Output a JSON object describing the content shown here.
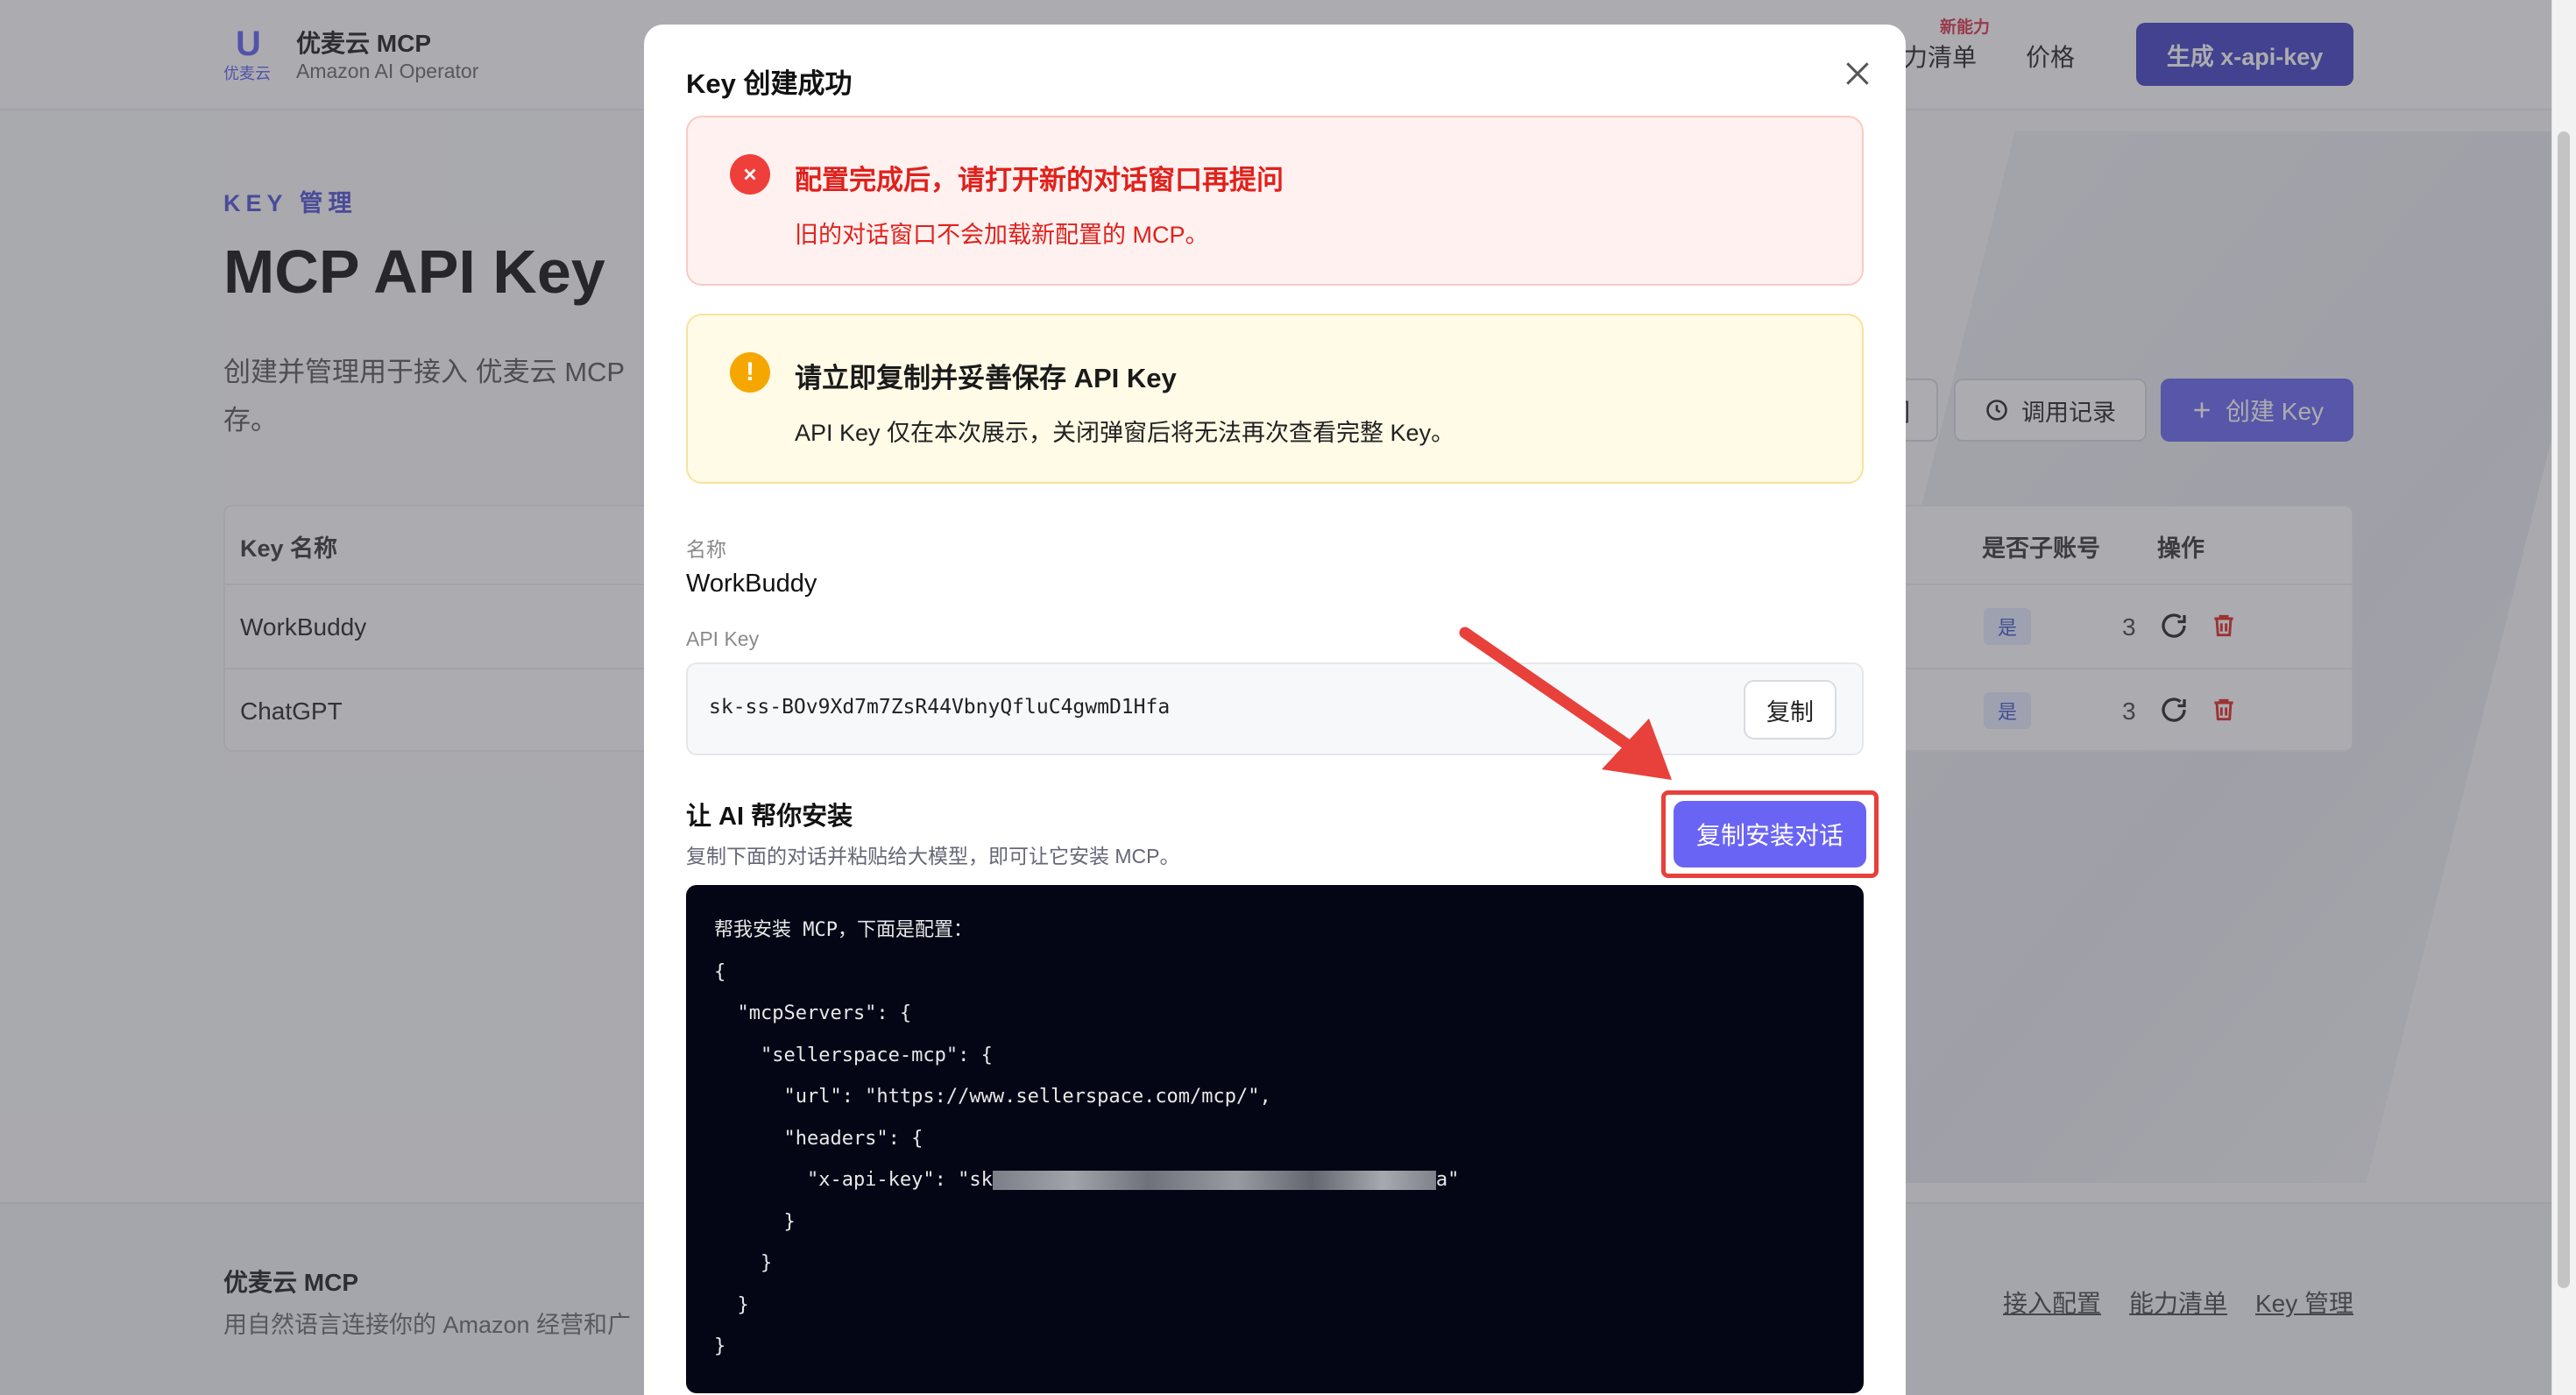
{
  "header": {
    "logo_letter": "U",
    "logo_text": "优麦云",
    "brand_name": "优麦云 MCP",
    "brand_sub": "Amazon AI Operator",
    "nav_capabilities": "力清单",
    "nav_badge": "新能力",
    "nav_pricing": "价格",
    "generate_button": "生成 x-api-key"
  },
  "page": {
    "kicker": "KEY 管理",
    "title": "MCP API Key",
    "description_line1": "创建并管理用于接入 优麦云 MCP",
    "description_line2": "存。",
    "toolbar": {
      "partial_button": "]",
      "history_button": "调用记录",
      "create_button": "创建 Key"
    },
    "table": {
      "columns": {
        "name": "Key 名称",
        "is_sub_account": "是否子账号",
        "actions": "操作"
      },
      "rows": [
        {
          "name": "WorkBuddy",
          "num": "3",
          "is_sub": "是"
        },
        {
          "name": "ChatGPT",
          "num": "3",
          "is_sub": "是"
        }
      ]
    }
  },
  "footer": {
    "brand": "优麦云 MCP",
    "description": "用自然语言连接你的 Amazon 经营和广",
    "links": [
      "接入配置",
      "能力清单",
      "Key 管理"
    ]
  },
  "modal": {
    "title": "Key 创建成功",
    "alert_error": {
      "title": "配置完成后，请打开新的对话窗口再提问",
      "text": "旧的对话窗口不会加载新配置的 MCP。"
    },
    "alert_warning": {
      "title": "请立即复制并妥善保存 API Key",
      "text": "API Key 仅在本次展示，关闭弹窗后将无法再次查看完整 Key。"
    },
    "name_label": "名称",
    "name_value": "WorkBuddy",
    "key_label": "API Key",
    "key_value": "sk-ss-BOv9Xd7m7ZsR44VbnyQfluC4gwmD1Hfa",
    "copy_button": "复制",
    "ai_section_title": "让 AI 帮你安装",
    "ai_section_desc": "复制下面的对话并粘贴给大模型，即可让它安装 MCP。",
    "copy_dialog_button": "复制安装对话",
    "code_lines": [
      "帮我安装 MCP，下面是配置：",
      "{",
      "  \"mcpServers\": {",
      "    \"sellerspace-mcp\": {",
      "      \"url\": \"https://www.sellerspace.com/mcp/\",",
      "      \"headers\": {",
      "        \"x-api-key\": \"sk",
      "      }",
      "    }",
      "  }",
      "}"
    ],
    "code_key_tail": "a\""
  },
  "colors": {
    "accent": "#6a64f4",
    "danger": "#e0211c",
    "warning": "#f5a700",
    "highlight": "#e8403b"
  },
  "icons": [
    "close-icon",
    "error-circle-icon",
    "warning-circle-icon",
    "history-icon",
    "plus-icon",
    "refresh-icon",
    "trash-icon",
    "arrow-annotation"
  ]
}
